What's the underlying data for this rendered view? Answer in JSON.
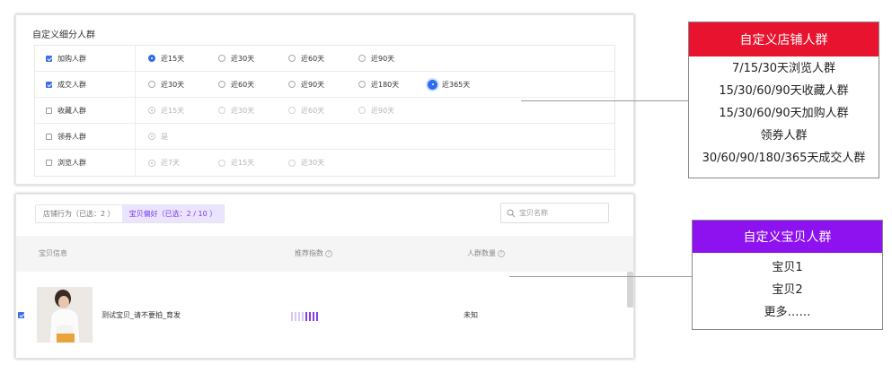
{
  "panel1": {
    "title": "自定义细分人群",
    "rows": [
      {
        "label": "加购人群",
        "checked": true,
        "options": [
          {
            "text": "近15天",
            "state": "on"
          },
          {
            "text": "近30天",
            "state": "off"
          },
          {
            "text": "近60天",
            "state": "off"
          },
          {
            "text": "近90天",
            "state": "off"
          }
        ]
      },
      {
        "label": "成交人群",
        "checked": true,
        "options": [
          {
            "text": "近30天",
            "state": "off"
          },
          {
            "text": "近60天",
            "state": "off"
          },
          {
            "text": "近90天",
            "state": "off"
          },
          {
            "text": "近180天",
            "state": "off"
          },
          {
            "text": "近365天",
            "state": "big"
          }
        ]
      },
      {
        "label": "收藏人群",
        "checked": false,
        "options": [
          {
            "text": "近15天",
            "state": "dison"
          },
          {
            "text": "近30天",
            "state": "dis"
          },
          {
            "text": "近60天",
            "state": "dis"
          },
          {
            "text": "近90天",
            "state": "dis"
          }
        ]
      },
      {
        "label": "领券人群",
        "checked": false,
        "options": [
          {
            "text": "是",
            "state": "dison"
          }
        ]
      },
      {
        "label": "浏览人群",
        "checked": false,
        "options": [
          {
            "text": "近7天",
            "state": "dison"
          },
          {
            "text": "近15天",
            "state": "dis"
          },
          {
            "text": "近30天",
            "state": "dis"
          }
        ]
      }
    ]
  },
  "panel2": {
    "tab_store": "店铺行为（已选：2 ）",
    "tab_product": "宝贝偏好（已选：2 / 10 ）",
    "search_placeholder": "宝贝名称",
    "col_info": "宝贝信息",
    "col_index": "推荐指数",
    "col_count": "人群数量",
    "product_name": "测试宝贝_请不要拍_育发",
    "product_count": "未知",
    "recommend_bars": 8,
    "recommend_bars_filled": 4
  },
  "callout_store": {
    "title": "自定义店铺人群",
    "color": "#e8142f",
    "lines": [
      "7/15/30天浏览人群",
      "15/30/60/90天收藏人群",
      "15/30/60/90天加购人群",
      "领券人群",
      "30/60/90/180/365天成交人群"
    ]
  },
  "callout_product": {
    "title": "自定义宝贝人群",
    "color": "#8e12f0",
    "lines": [
      "宝贝1",
      "宝贝2",
      "更多……"
    ]
  }
}
